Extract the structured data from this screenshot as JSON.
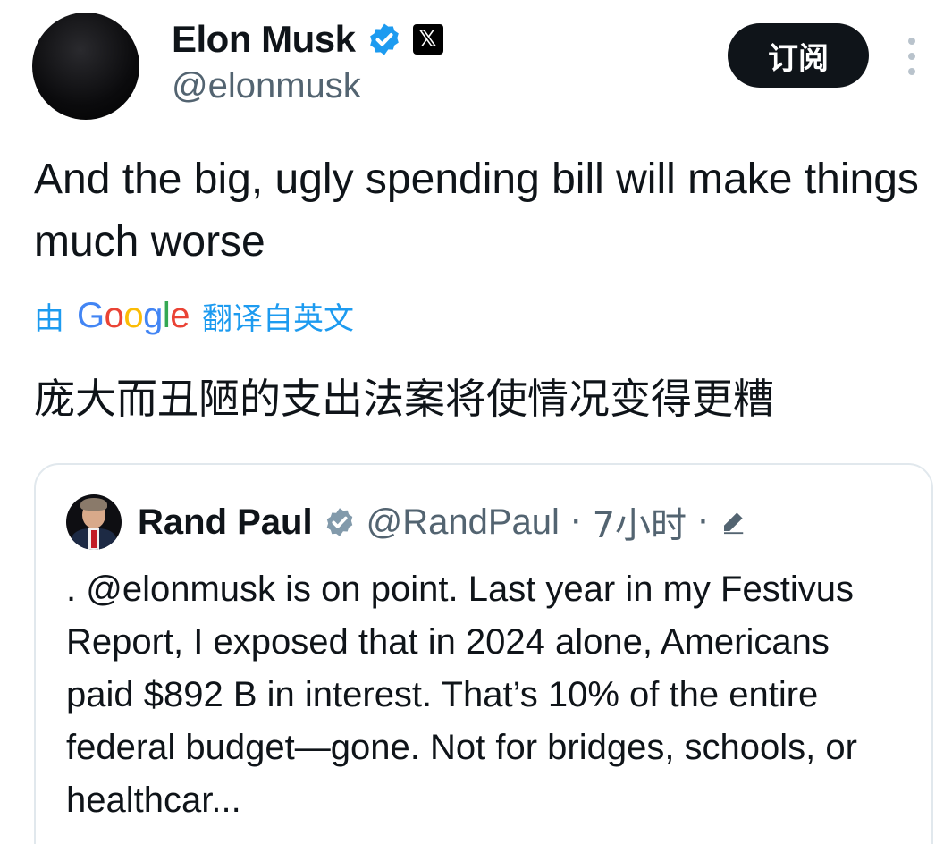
{
  "author": {
    "display_name": "Elon Musk",
    "handle": "@elonmusk",
    "x_badge": "𝕏"
  },
  "actions": {
    "subscribe_label": "订阅"
  },
  "tweet": {
    "text": "And the big, ugly spending bill will make things much worse",
    "translation_prefix": "由",
    "translation_provider": "Google",
    "translation_suffix": "翻译自英文",
    "translated_text": "庞大而丑陋的支出法案将使情况变得更糟"
  },
  "quoted_tweet": {
    "display_name": "Rand Paul",
    "handle": "@RandPaul",
    "separator": "·",
    "time": "7小时",
    "text": ". @elonmusk is on point. Last year in my Festivus Report, I exposed that in 2024 alone, Americans paid $892 B in interest. That’s 10% of the entire federal budget—gone. Not for bridges, schools, or healthcar..."
  },
  "icons": {
    "verified": "verified-badge-icon",
    "x": "x-logo-icon",
    "more": "more-vertical-icon",
    "edit": "pencil-icon"
  },
  "colors": {
    "accent": "#1d9bf0",
    "text": "#0f1419",
    "muted": "#536471",
    "border": "#e1e8ed",
    "button_bg": "#0f1419"
  }
}
